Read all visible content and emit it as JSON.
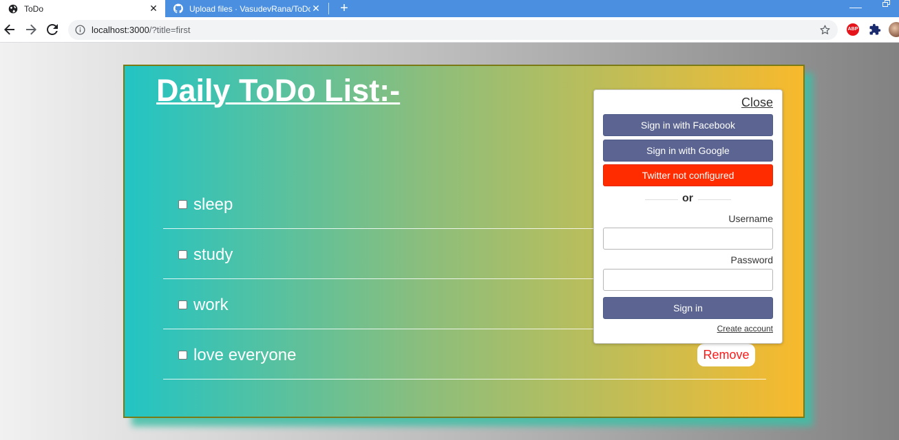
{
  "browser": {
    "tabs": [
      {
        "title": "ToDo",
        "active": true
      },
      {
        "title": "Upload files · VasudevRana/ToDo",
        "active": false
      }
    ],
    "url_host": "localhost:3000",
    "url_rest": "/?title=first",
    "extensions": {
      "abp": "ABP"
    }
  },
  "page": {
    "title": "Daily ToDo List:-",
    "items": [
      {
        "text": "sleep",
        "checked": false
      },
      {
        "text": "study",
        "checked": false
      },
      {
        "text": "work",
        "checked": false
      },
      {
        "text": "love everyone",
        "checked": false
      }
    ],
    "remove_label": "Remove"
  },
  "login": {
    "close": "Close",
    "facebook": "Sign in with Facebook",
    "google": "Sign in with Google",
    "twitter": "Twitter not configured",
    "or": "or",
    "username_label": "Username",
    "password_label": "Password",
    "signin": "Sign in",
    "create": "Create account"
  },
  "colors": {
    "tabstrip": "#4a8fe0",
    "button_blue": "#5c6592",
    "twitter_red": "#ff2c00",
    "remove_red": "#ff1a1a",
    "card_left": "#22c4c4",
    "card_right": "#f8b92c"
  }
}
